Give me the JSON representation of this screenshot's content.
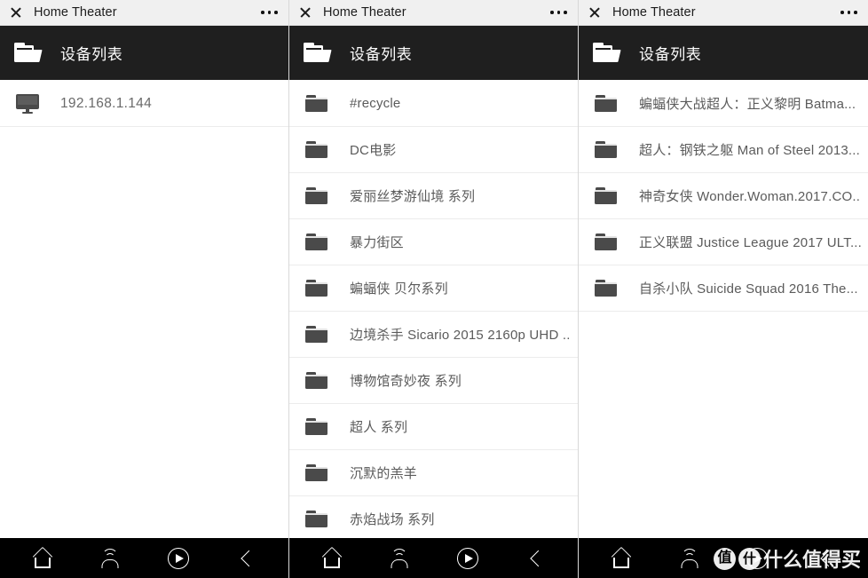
{
  "window": {
    "title": "Home Theater",
    "close_icon": "close-icon",
    "menu_icon": "more-options-icon"
  },
  "header": {
    "icon": "folder-open-icon",
    "title": "设备列表"
  },
  "colors": {
    "titlebar_bg": "#f0f0f0",
    "header_bg": "#1f1f1f",
    "navbar_bg": "#000000",
    "list_bg": "#ffffff",
    "row_text": "#5b5b5b",
    "divider": "#ececec"
  },
  "panels": [
    {
      "id": "panel-devices",
      "rows": [
        {
          "icon": "monitor-icon",
          "label": "192.168.1.144"
        }
      ]
    },
    {
      "id": "panel-folders",
      "rows": [
        {
          "icon": "folder-icon",
          "label": "#recycle"
        },
        {
          "icon": "folder-icon",
          "label": "DC电影"
        },
        {
          "icon": "folder-icon",
          "label": "爱丽丝梦游仙境 系列"
        },
        {
          "icon": "folder-icon",
          "label": "暴力街区"
        },
        {
          "icon": "folder-icon",
          "label": "蝙蝠侠 贝尔系列"
        },
        {
          "icon": "folder-icon",
          "label": "边境杀手 Sicario 2015 2160p UHD ..."
        },
        {
          "icon": "folder-icon",
          "label": "博物馆奇妙夜 系列"
        },
        {
          "icon": "folder-icon",
          "label": "超人 系列"
        },
        {
          "icon": "folder-icon",
          "label": "沉默的羔羊"
        },
        {
          "icon": "folder-icon",
          "label": "赤焰战场 系列"
        }
      ]
    },
    {
      "id": "panel-dc-movies",
      "rows": [
        {
          "icon": "folder-icon",
          "label": "蝙蝠侠大战超人：正义黎明 Batma..."
        },
        {
          "icon": "folder-icon",
          "label": "超人：钢铁之躯 Man of Steel 2013..."
        },
        {
          "icon": "folder-icon",
          "label": "神奇女侠 Wonder.Woman.2017.CO..."
        },
        {
          "icon": "folder-icon",
          "label": "正义联盟 Justice League 2017 ULT..."
        },
        {
          "icon": "folder-icon",
          "label": "自杀小队 Suicide Squad 2016 The..."
        }
      ]
    }
  ],
  "navbar": {
    "buttons": [
      {
        "icon": "home-icon",
        "name": "nav-home"
      },
      {
        "icon": "cast-icon",
        "name": "nav-cast"
      },
      {
        "icon": "play-icon",
        "name": "nav-play"
      },
      {
        "icon": "back-icon",
        "name": "nav-back"
      }
    ]
  },
  "watermark": {
    "badge1": "值",
    "badge2": "什",
    "text": "什么值得买"
  }
}
